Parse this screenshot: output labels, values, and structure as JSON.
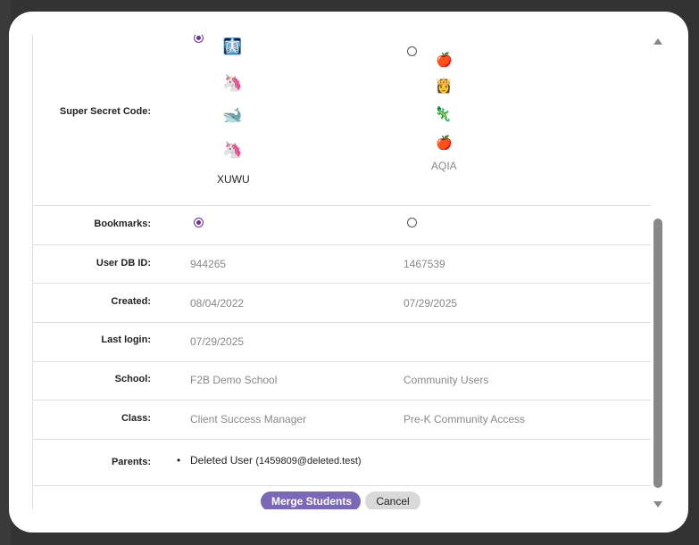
{
  "modal": {
    "super_secret_code": {
      "label": "Super Secret Code:",
      "left": {
        "selected": true,
        "icons": [
          "x-ray-icon",
          "unicorn-icon",
          "whale-icon",
          "unicorn-icon"
        ],
        "glyphs": [
          "🩻",
          "🦄",
          "🐋",
          "🦄"
        ],
        "code": "XUWU"
      },
      "right": {
        "selected": false,
        "icons": [
          "apple-icon",
          "princess-icon",
          "lizard-icon",
          "apple-icon"
        ],
        "glyphs": [
          "🍎",
          "👸",
          "🦎",
          "🍎"
        ],
        "code": "AQIA"
      }
    },
    "bookmarks": {
      "label": "Bookmarks:",
      "left_selected": true,
      "right_selected": false
    },
    "user_db_id": {
      "label": "User DB ID:",
      "left": "944265",
      "right": "1467539"
    },
    "created": {
      "label": "Created:",
      "left": "08/04/2022",
      "right": "07/29/2025"
    },
    "last_login": {
      "label": "Last login:",
      "left": "07/29/2025",
      "right": ""
    },
    "school": {
      "label": "School:",
      "left": "F2B Demo School",
      "right": "Community Users"
    },
    "class": {
      "label": "Class:",
      "left": "Client Success Manager",
      "right": "Pre-K Community Access"
    },
    "parents": {
      "label": "Parents:",
      "bullet": "•",
      "name": "Deleted User",
      "email": "(1459809@deleted.test)"
    },
    "buttons": {
      "merge": "Merge Students",
      "cancel": "Cancel"
    }
  },
  "colors": {
    "radio_selected": "#6a2f9e",
    "merge_button": "#7b68b8",
    "cancel_button": "#d9d9d9"
  }
}
